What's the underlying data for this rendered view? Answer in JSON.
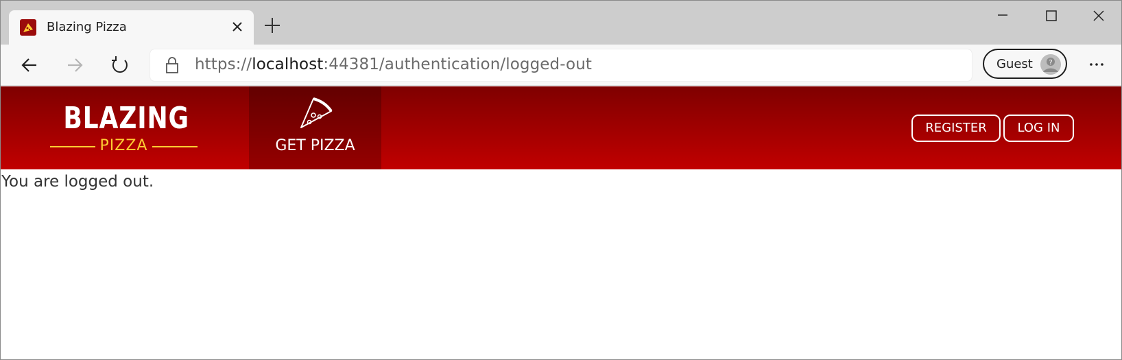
{
  "browser": {
    "tab": {
      "title": "Blazing Pizza"
    },
    "address": {
      "scheme": "https://",
      "host": "localhost",
      "rest": ":44381/authentication/logged-out"
    },
    "profile": {
      "label": "Guest"
    }
  },
  "header": {
    "logo": {
      "top": "BLAZING",
      "bottom": "PIZZA"
    },
    "nav": {
      "get_pizza": "GET PIZZA"
    },
    "auth": {
      "register": "REGISTER",
      "login": "LOG IN"
    }
  },
  "main": {
    "message": "You are logged out."
  },
  "colors": {
    "brand_dark": "#7f0000",
    "brand": "#c10000",
    "logo_accent": "#ffcc33"
  }
}
